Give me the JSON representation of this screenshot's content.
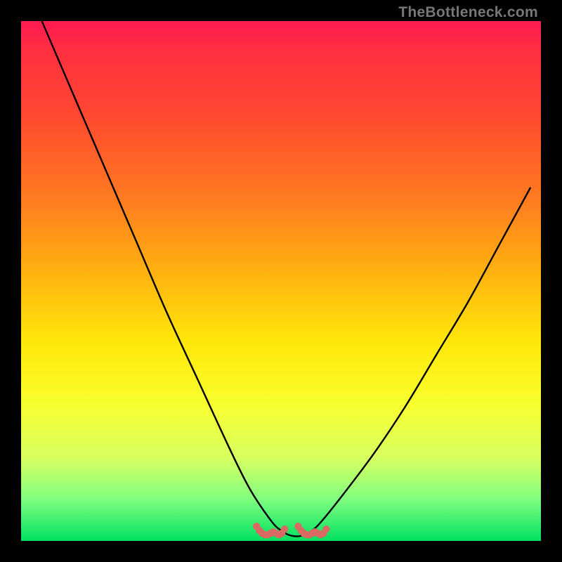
{
  "watermark": "TheBottleneck.com",
  "colors": {
    "frame": "#000000",
    "curve": "#000000",
    "dots": "#d86a63",
    "gradient_top": "#ff1a50",
    "gradient_bottom": "#00e060"
  },
  "chart_data": {
    "type": "line",
    "title": "",
    "xlabel": "",
    "ylabel": "",
    "xlim": [
      0,
      100
    ],
    "ylim": [
      0,
      100
    ],
    "series": [
      {
        "name": "bottleneck-curve",
        "x": [
          4,
          10,
          16,
          22,
          28,
          34,
          40,
          44,
          48,
          50,
          52,
          54,
          56,
          58,
          62,
          68,
          74,
          80,
          86,
          92,
          98
        ],
        "values": [
          100,
          86,
          72,
          58,
          44,
          31,
          18,
          10,
          4,
          2,
          1,
          1,
          2,
          4,
          9,
          17,
          26,
          36,
          46,
          57,
          68
        ]
      }
    ],
    "annotations": [
      {
        "name": "cluster-left",
        "x": 48,
        "y": 2
      },
      {
        "name": "cluster-right",
        "x": 56,
        "y": 2
      }
    ]
  }
}
